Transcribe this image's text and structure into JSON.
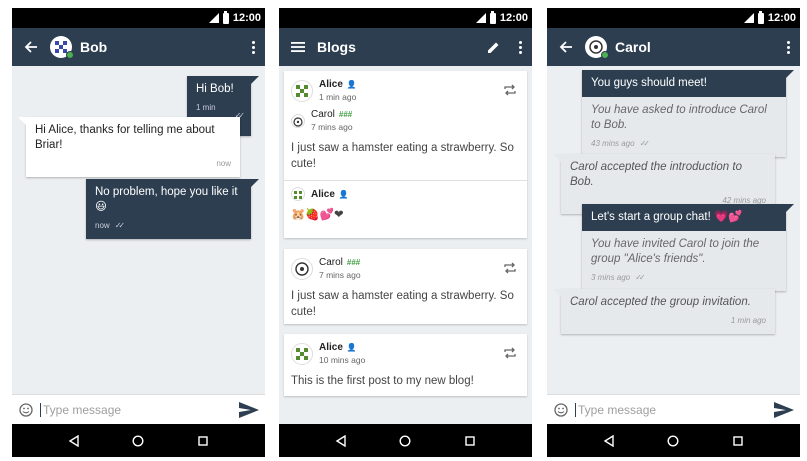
{
  "status_time": "12:00",
  "input_placeholder": "Type message",
  "chat_bob": {
    "title": "Bob",
    "messages": [
      {
        "text": "Hi Bob!",
        "time": "1 min ago"
      },
      {
        "text": "Hi Alice, thanks for telling me about Briar!",
        "time": "now"
      },
      {
        "text": "No problem, hope you like it 😃",
        "time": "now"
      }
    ]
  },
  "blogs": {
    "title": "Blogs",
    "posts": [
      {
        "author": "Alice",
        "time": "1 min ago",
        "reblogged": {
          "author": "Carol",
          "badge": "###",
          "time": "7 mins ago",
          "text": "I just saw a hamster eating a strawberry. So cute!"
        },
        "comment": {
          "author": "Alice",
          "text": "🐹🍓💕❤"
        }
      },
      {
        "author": "Carol",
        "badge": "###",
        "time": "7 mins ago",
        "text": "I just saw a hamster eating a strawberry. So cute!"
      },
      {
        "author": "Alice",
        "time": "10 mins ago",
        "text": "This is the first post to my new blog!"
      }
    ]
  },
  "chat_carol": {
    "title": "Carol",
    "messages": [
      {
        "text": "You guys should meet!",
        "notice": "You have asked to introduce Carol to Bob.",
        "time": "43 mins ago"
      },
      {
        "text": "Carol accepted the introduction to Bob.",
        "time": "42 mins ago"
      },
      {
        "text": "Let's start a group chat! 💗💕",
        "notice": "You have invited Carol to join the group \"Alice's friends\".",
        "time": "3 mins ago"
      },
      {
        "text": "Carol accepted the group invitation.",
        "time": "1 min ago"
      }
    ]
  },
  "colors": {
    "toolbar": "#2c3e50",
    "background": "#eceff1",
    "online": "#4caf50",
    "badge": "#43a047"
  },
  "icons": [
    "back-arrow-icon",
    "menu-icon",
    "pencil-icon",
    "overflow-icon",
    "emoji-icon",
    "send-icon",
    "reblog-icon",
    "person-icon",
    "nav-back-icon",
    "nav-home-icon",
    "nav-recents-icon"
  ]
}
